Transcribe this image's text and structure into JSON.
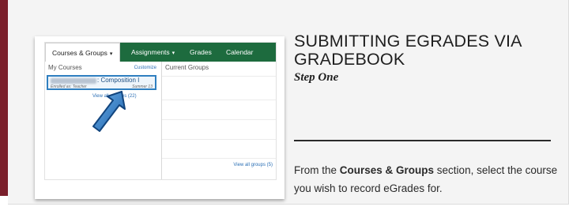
{
  "screenshot": {
    "nav": {
      "courses_groups": "Courses & Groups",
      "assignments": "Assignments",
      "grades": "Grades",
      "calendar": "Calendar",
      "caret": "▾"
    },
    "my_courses": {
      "title": "My Courses",
      "customize": "Customize",
      "course_name": ": Composition I",
      "enrolled_as": "Enrolled as: Teacher",
      "term": "Summer 13",
      "view_all": "View all courses (22)"
    },
    "groups": {
      "title": "Current Groups",
      "view_all": "View all groups (5)"
    }
  },
  "content": {
    "title": "SUBMITTING EGRADES VIA GRADEBOOK",
    "step": "Step One",
    "desc_prefix": "From the ",
    "desc_bold": "Courses & Groups",
    "desc_suffix": " section, select the course you wish to record eGrades for."
  },
  "colors": {
    "nav_green": "#1d6b3e",
    "accent_maroon": "#7a1f2b",
    "highlight_blue": "#2f7fc0"
  }
}
